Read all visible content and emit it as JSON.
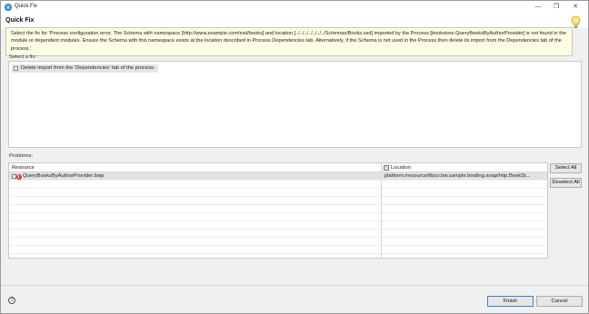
{
  "window": {
    "title": "Quick Fix",
    "controls": {
      "minimize": "—",
      "maximize": "❐",
      "close": "✕"
    }
  },
  "header": {
    "title": "Quick Fix",
    "icon": "lightbulb-icon"
  },
  "message": "Select the fix for 'Process configuration error. The Schema with namespace [http://www.example.com/xsd/books] and location [../../../../../../../Schemas/Books.xsd] imported by the Process [bookstore.QueryBooksByAuthorProvider] is not found in the module or dependent modules.  Ensure the Schema with this namespace exists at the location described in Process Dependencies tab. Alternatively, if the Schema is not used in the Process then delete its import from the Dependencies tab of the process.'.",
  "fix_section": {
    "label": "Select a fix:",
    "items": [
      {
        "label": "Delete import from the 'Dependencies' tab of the process."
      }
    ]
  },
  "problems_section": {
    "label": "Problems:",
    "columns": {
      "resource": "Resource",
      "location": "Location"
    },
    "rows": [
      {
        "resource": "QueryBooksByAuthorProvider.bwp",
        "location": "platform:/resource/tibco.bw.sample.binding.soap/http.BookSt..."
      }
    ],
    "select_all": "Select All",
    "deselect_all": "Deselect All"
  },
  "footer": {
    "help": "?",
    "finish": "Finish",
    "cancel": "Cancel"
  },
  "colors": {
    "tooltip_bg": "#fdfde4",
    "selection": "#e2e2e2",
    "error": "#d83b3b",
    "default_button_border": "#3c7fd4"
  }
}
